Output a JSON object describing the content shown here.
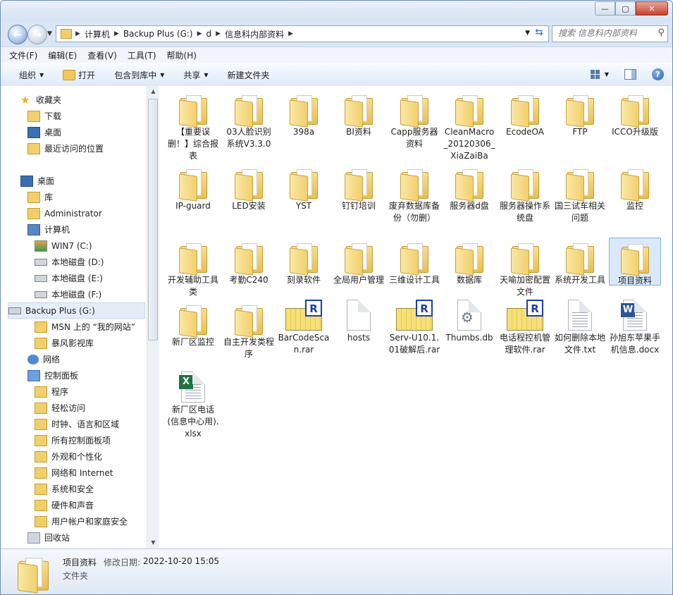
{
  "window": {
    "controls": [
      "0",
      "1",
      "r"
    ]
  },
  "address": {
    "segments": [
      "计算机",
      "Backup Plus (G:)",
      "d",
      "信息科内部资料"
    ]
  },
  "search": {
    "placeholder": "搜索 信息科内部资料"
  },
  "menu": [
    "文件(F)",
    "编辑(E)",
    "查看(V)",
    "工具(T)",
    "帮助(H)"
  ],
  "toolbar": {
    "organize": "组织",
    "open": "打开",
    "include": "包含到库中",
    "share": "共享",
    "new_folder": "新建文件夹"
  },
  "nav": {
    "items": [
      {
        "label": "收藏夹",
        "icon": "star-icon"
      },
      {
        "label": "下载",
        "icon": "download-folder-icon"
      },
      {
        "label": "桌面",
        "icon": "desktop-icon"
      },
      {
        "label": "最近访问的位置",
        "icon": "recent-places-icon"
      },
      {
        "label": "桌面",
        "icon": "desktop-icon"
      },
      {
        "label": "库",
        "icon": "library-icon"
      },
      {
        "label": "Administrator",
        "icon": "user-folder-icon"
      },
      {
        "label": "计算机",
        "icon": "computer-icon"
      },
      {
        "label": "WIN7 (C:)",
        "icon": "system-drive-icon"
      },
      {
        "label": "本地磁盘 (D:)",
        "icon": "drive-icon"
      },
      {
        "label": "本地磁盘 (E:)",
        "icon": "drive-icon"
      },
      {
        "label": "本地磁盘 (F:)",
        "icon": "drive-icon"
      },
      {
        "label": "Backup Plus (G:)",
        "icon": "drive-icon"
      },
      {
        "label": "MSN 上的 “我的网站”",
        "icon": "folder-icon"
      },
      {
        "label": "暴风影视库",
        "icon": "media-library-icon"
      },
      {
        "label": "网络",
        "icon": "network-icon"
      },
      {
        "label": "控制面板",
        "icon": "control-panel-icon"
      },
      {
        "label": "程序",
        "icon": "programs-icon"
      },
      {
        "label": "轻松访问",
        "icon": "ease-of-access-icon"
      },
      {
        "label": "时钟、语言和区域",
        "icon": "clock-language-icon"
      },
      {
        "label": "所有控制面板项",
        "icon": "all-items-icon"
      },
      {
        "label": "外观和个性化",
        "icon": "appearance-icon"
      },
      {
        "label": "网络和 Internet",
        "icon": "network-internet-icon"
      },
      {
        "label": "系统和安全",
        "icon": "system-security-icon"
      },
      {
        "label": "硬件和声音",
        "icon": "hardware-sound-icon"
      },
      {
        "label": "用户帐户和家庭安全",
        "icon": "user-accounts-icon"
      },
      {
        "label": "回收站",
        "icon": "recycle-bin-icon"
      }
    ]
  },
  "files": [
    {
      "name": "【重要误删！】综合报表",
      "type": "folder"
    },
    {
      "name": "03人脸识别系统V3.3.0",
      "type": "folder"
    },
    {
      "name": "398a",
      "type": "folder"
    },
    {
      "name": "BI资料",
      "type": "folder"
    },
    {
      "name": "Capp服务器资料",
      "type": "folder"
    },
    {
      "name": "CleanMacro_20120306_XiaZaiBa",
      "type": "folder"
    },
    {
      "name": "EcodeOA",
      "type": "folder"
    },
    {
      "name": "FTP",
      "type": "folder"
    },
    {
      "name": "ICCO升级版",
      "type": "folder"
    },
    {
      "name": "IP-guard",
      "type": "folder"
    },
    {
      "name": "LED安装",
      "type": "folder"
    },
    {
      "name": "YST",
      "type": "folder"
    },
    {
      "name": "钉钉培训",
      "type": "folder"
    },
    {
      "name": "废弃数据库备份（勿删）",
      "type": "folder"
    },
    {
      "name": "服务器d盘",
      "type": "folder"
    },
    {
      "name": "服务器操作系统盘",
      "type": "folder"
    },
    {
      "name": "国三试车相关问题",
      "type": "folder"
    },
    {
      "name": "监控",
      "type": "folder"
    },
    {
      "name": "开发辅助工具类",
      "type": "folder"
    },
    {
      "name": "考勤C240",
      "type": "folder"
    },
    {
      "name": "刻录软件",
      "type": "folder"
    },
    {
      "name": "全局用户管理",
      "type": "folder"
    },
    {
      "name": "三维设计工具",
      "type": "folder"
    },
    {
      "name": "数据库",
      "type": "folder"
    },
    {
      "name": "天喻加密配置文件",
      "type": "folder"
    },
    {
      "name": "系统开发工具",
      "type": "folder"
    },
    {
      "name": "项目资料",
      "type": "folder",
      "selected": true
    },
    {
      "name": "新厂区监控",
      "type": "folder"
    },
    {
      "name": "自主开发类程序",
      "type": "folder"
    },
    {
      "name": "BarCodeScan.rar",
      "type": "rar"
    },
    {
      "name": "hosts",
      "type": "file"
    },
    {
      "name": "Serv-U10.1.01破解后.rar",
      "type": "rar"
    },
    {
      "name": "Thumbs.db",
      "type": "db"
    },
    {
      "name": "电话程控机管理软件.rar",
      "type": "rar"
    },
    {
      "name": "如何删除本地文件.txt",
      "type": "txt"
    },
    {
      "name": "孙旭东苹果手机信息.docx",
      "type": "docx"
    },
    {
      "name": "新厂区电话(信息中心用).xlsx",
      "type": "xlsx"
    }
  ],
  "details": {
    "name": "项目资料",
    "modified_label": "修改日期:",
    "modified_value": "2022-10-20 15:05",
    "type": "文件夹"
  },
  "colors": {
    "accent": "#3c7fd9",
    "folder": "#f1cf6d",
    "rar_badge": "#1b3fa8",
    "word": "#2a5699",
    "excel": "#1f7244"
  }
}
